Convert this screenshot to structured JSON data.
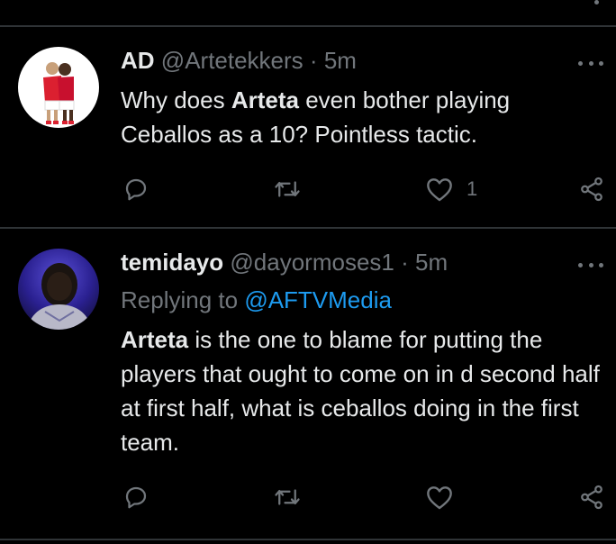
{
  "tweets": [
    {
      "name": "AD",
      "handle": "@Artetekkers",
      "separator": "·",
      "time": "5m",
      "body_bold": "",
      "body_lines": [
        "Why does ",
        "Arteta",
        " even bother playing",
        "Ceballos as a 10? Pointless tactic."
      ],
      "likes": "1",
      "avatar_icon": "arsenal-players-avatar"
    },
    {
      "name": "temidayo",
      "handle": "@dayormoses1",
      "separator": "·",
      "time": "5m",
      "replying_prefix": "Replying to ",
      "replying_to": "@AFTVMedia",
      "body_bold": "Arteta",
      "body_rest": " is the one to blame for putting the players that ought to come on in d second half at first half, what is ceballos doing in the first team.",
      "likes": "",
      "avatar_icon": "person-photo-avatar"
    }
  ],
  "colors": {
    "background": "#000000",
    "divider": "#2f3336",
    "text": "#e7e9ea",
    "muted": "#71767b",
    "link": "#1d9bf0"
  },
  "icons": [
    "more-icon",
    "reply-icon",
    "retweet-icon",
    "like-icon",
    "share-icon"
  ]
}
